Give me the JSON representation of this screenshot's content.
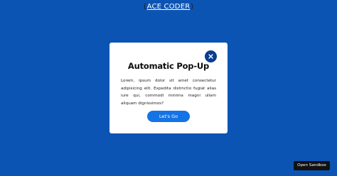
{
  "header": {
    "brand_left_bracket": "{",
    "brand_text": "ACE CODER",
    "brand_right_bracket": "}"
  },
  "modal": {
    "title": "Automatic Pop-Up",
    "body": "Lorem, ipsum dolor sit amet consectetur adipisicing elit. Expedita distinctio fugiat alias iure qui, commodi minima magni ullam aliquam dignissimos?",
    "cta_label": "Let's Go",
    "close_icon": "close-icon"
  },
  "footer": {
    "sandbox_label": "Open Sandbox"
  },
  "colors": {
    "background": "#0b54b3",
    "modal_background": "#ffffff",
    "close_button": "#0a3d8f",
    "cta_button": "#1573e6",
    "sandbox_button": "#111111"
  }
}
